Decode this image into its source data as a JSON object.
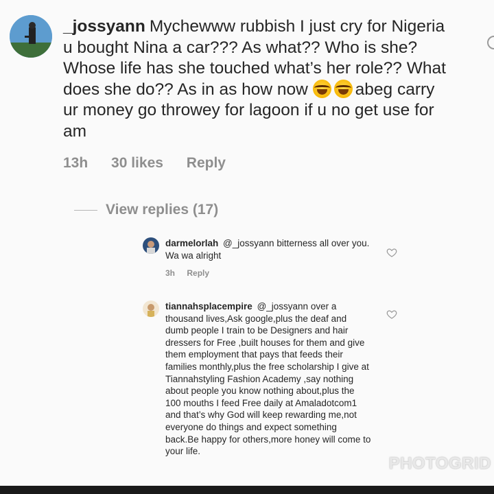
{
  "main_comment": {
    "username": "_jossyann",
    "text_before_emoji": "Mychewww rubbish I just cry for Nigeria u bought Nina a car??? As what?? Who is she? Whose life has she touched what’s her role?? What does she do?? As in as how now",
    "text_after_emoji": "abeg carry ur money go throwey for lagoon if u no get use for am",
    "emojis": [
      "face-with-tears-of-joy",
      "face-with-tears-of-joy"
    ],
    "time": "13h",
    "likes": "30 likes",
    "reply_label": "Reply"
  },
  "view_replies": "View replies (17)",
  "replies": [
    {
      "username": "darmelorlah",
      "mention": "@_jossyann",
      "text": "bitterness all over you. Wa wa alright",
      "time": "3h",
      "reply_label": "Reply"
    },
    {
      "username": "tiannahsplacempire",
      "mention": "@_jossyann",
      "text": "over a thousand lives,Ask google,plus the deaf and dumb people I train to be Designers and hair dressers for Free ,built houses for them and give them employment that pays that feeds their families monthly,plus the free scholarship I give at Tiannahstyling Fashion Academy ,say nothing about people you know nothing about,plus the 100 mouths I feed Free daily at Amaladotcom1 and that’s why God will keep rewarding me,not everyone do things and expect something back.Be happy for others,more honey will come to your life."
    }
  ],
  "watermark": "PHOTOGRID"
}
